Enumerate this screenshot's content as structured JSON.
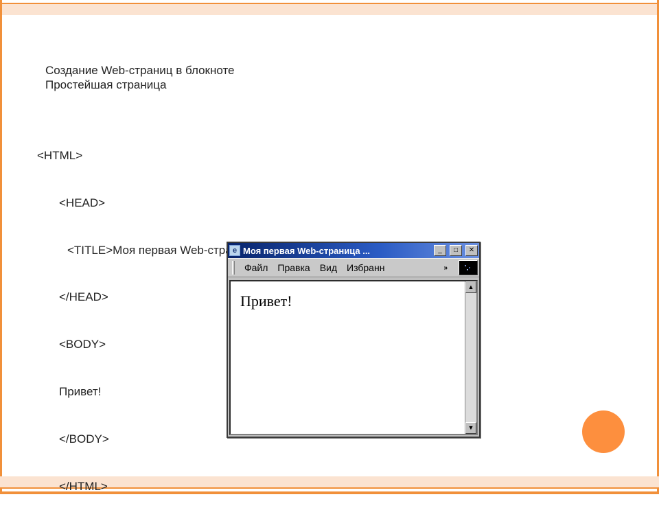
{
  "heading": {
    "line1": "Создание Web-страниц в блокноте",
    "line2": "Простейшая страница"
  },
  "code": {
    "l1": "<HTML>",
    "l2": "<HEAD>",
    "l3": "<TITLE>Моя первая Web-страница</TITLE>",
    "l4": "</HEAD>",
    "l5": "<BODY>",
    "l6": "Привет!",
    "l7": "</BODY>",
    "l8": "</HTML>"
  },
  "browser": {
    "title": "Моя первая Web-страница ...",
    "menu": {
      "file": "Файл",
      "edit": "Правка",
      "view": "Вид",
      "fav": "Избранн",
      "more": "»"
    },
    "content": "Привет!",
    "buttons": {
      "min": "_",
      "max": "□",
      "close": "✕"
    },
    "scroll": {
      "up": "▲",
      "down": "▼"
    }
  }
}
